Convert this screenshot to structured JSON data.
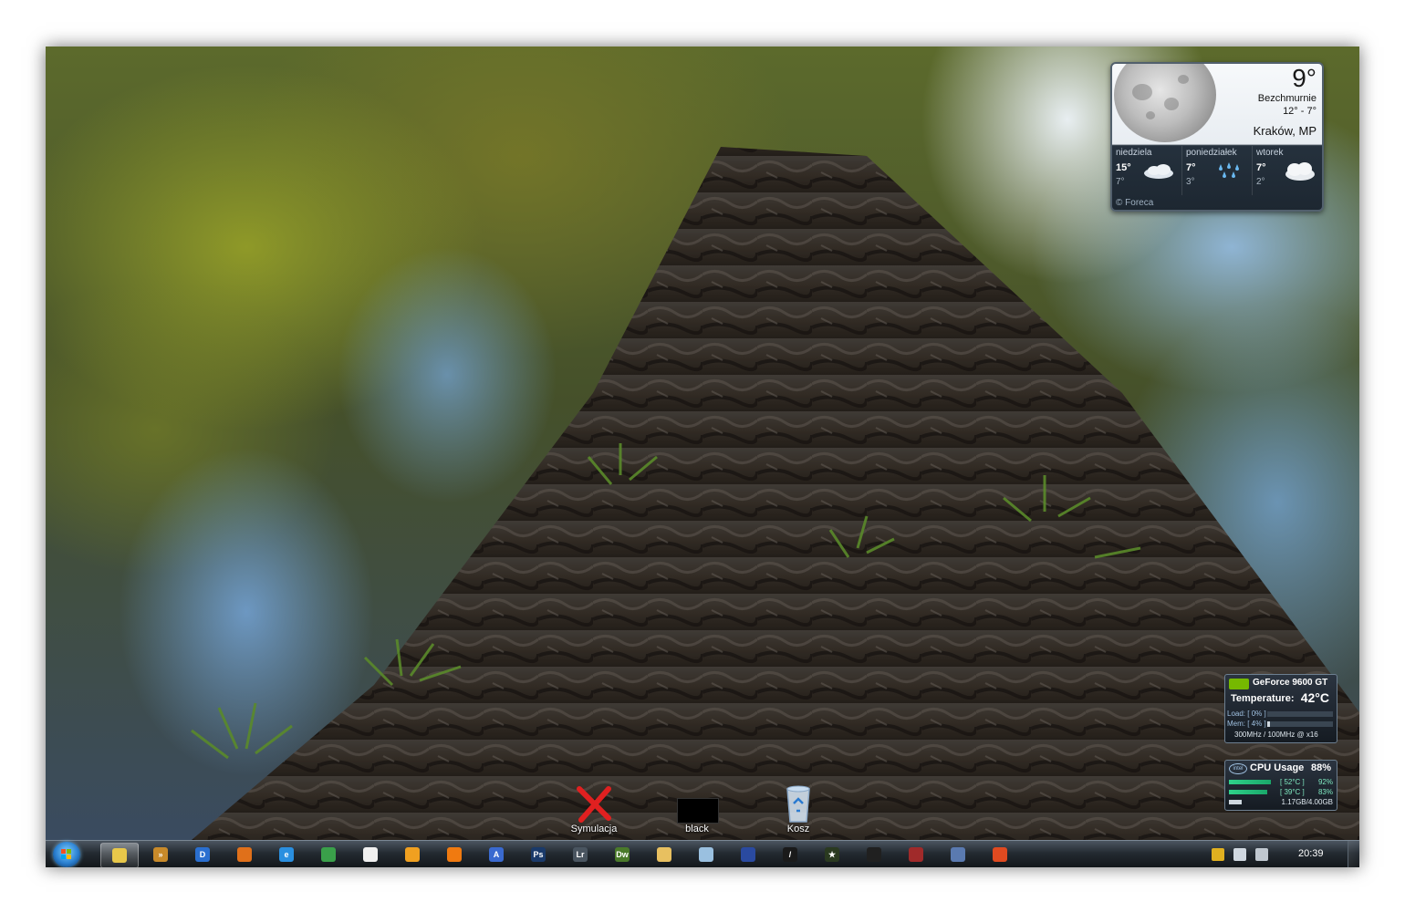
{
  "weather": {
    "temp": "9°",
    "condition": "Bezchmurnie",
    "range": "12°  -  7°",
    "city": "Kraków, MP",
    "days": [
      {
        "name": "niedziela",
        "hi": "15°",
        "lo": "7°",
        "icon": "cloud-icon"
      },
      {
        "name": "poniedziałek",
        "hi": "7°",
        "lo": "3°",
        "icon": "rain-icon"
      },
      {
        "name": "wtorek",
        "hi": "7°",
        "lo": "2°",
        "icon": "cloudy-icon"
      }
    ],
    "footer": "© Foreca"
  },
  "gpu": {
    "name": "GeForce 9600 GT",
    "temp_label": "Temperature:",
    "temp_value": "42°C",
    "load_label": "Load: [ 0% ]",
    "mem_label": "Mem: [ 4% ]",
    "load": 0,
    "mem": 4,
    "clock": "300MHz / 100MHz @ x16"
  },
  "cpu": {
    "brand": "intel",
    "title": "CPU Usage",
    "value": "88%",
    "cores": [
      {
        "temp": "[ 52°C ]",
        "percent": "92%",
        "level": 0.92
      },
      {
        "temp": "[ 39°C ]",
        "percent": "83%",
        "level": 0.83
      }
    ],
    "ram": "1.17GB/4.00GB",
    "ram_level": 0.29
  },
  "desktop_icons": [
    {
      "label": "Symulacja",
      "icon": "red-x-icon"
    },
    {
      "label": "black",
      "icon": "black-box-icon"
    },
    {
      "label": "Kosz",
      "icon": "recycle-bin-icon"
    }
  ],
  "taskbar": {
    "items": [
      {
        "name": "explorer",
        "glyph": "",
        "color": "#e8c84a",
        "active": true
      },
      {
        "name": "app-arrow",
        "glyph": "»",
        "color": "#c88a2a"
      },
      {
        "name": "media-player",
        "glyph": "D",
        "color": "#2a6fd0"
      },
      {
        "name": "firefox",
        "glyph": "",
        "color": "#e0701a"
      },
      {
        "name": "internet-explorer",
        "glyph": "e",
        "color": "#2a8fe0"
      },
      {
        "name": "chrome",
        "glyph": "",
        "color": "#3aa04a"
      },
      {
        "name": "app-cards",
        "glyph": "",
        "color": "#f0f0f0"
      },
      {
        "name": "orange-app",
        "glyph": "",
        "color": "#f0a020"
      },
      {
        "name": "vlc",
        "glyph": "",
        "color": "#f07a10"
      },
      {
        "name": "app-a",
        "glyph": "A",
        "color": "#3a6ad0"
      },
      {
        "name": "photoshop",
        "glyph": "Ps",
        "color": "#1a3a6a"
      },
      {
        "name": "lightroom",
        "glyph": "Lr",
        "color": "#4a5560"
      },
      {
        "name": "dreamweaver",
        "glyph": "Dw",
        "color": "#4a7a2a"
      },
      {
        "name": "folder",
        "glyph": "",
        "color": "#e8c060"
      },
      {
        "name": "notepad",
        "glyph": "",
        "color": "#9ac0e0"
      },
      {
        "name": "floppy",
        "glyph": "",
        "color": "#2a4aa0"
      },
      {
        "name": "app-slash",
        "glyph": "/",
        "color": "#1a1a1a"
      },
      {
        "name": "app-star",
        "glyph": "★",
        "color": "#2a3a20"
      },
      {
        "name": "app-bug",
        "glyph": "",
        "color": "#202020"
      },
      {
        "name": "app-tools",
        "glyph": "",
        "color": "#a02a2a"
      },
      {
        "name": "app-gear",
        "glyph": "",
        "color": "#5a7ab0"
      },
      {
        "name": "app-fire",
        "glyph": "",
        "color": "#e04a20"
      }
    ],
    "tray": [
      {
        "name": "msn-tray-icon",
        "color": "#e0b020"
      },
      {
        "name": "clock-tray-icon",
        "color": "#d0d8e0"
      },
      {
        "name": "network-tray-icon",
        "color": "#c0c8d0"
      }
    ],
    "time": "20:39"
  }
}
